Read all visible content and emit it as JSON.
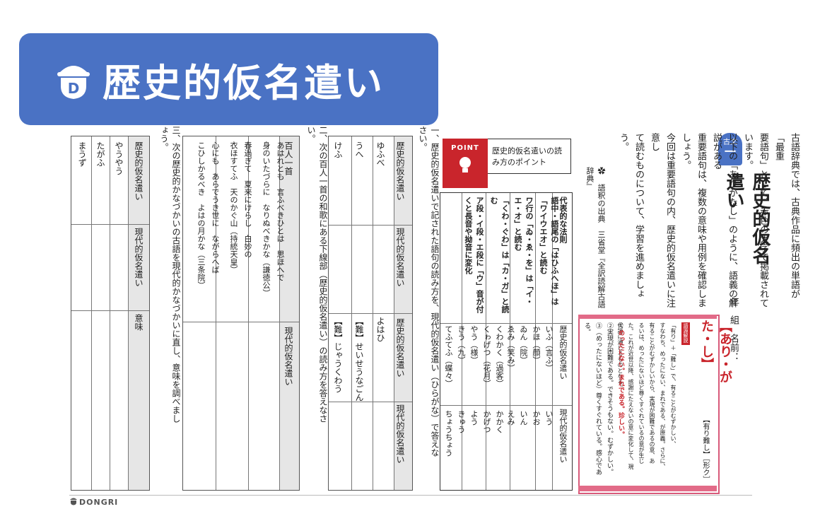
{
  "banner": {
    "title": "歴史的仮名遣い"
  },
  "header": {
    "badge_label": "古文",
    "badge_number": "一",
    "title": "歴史的仮名遣い",
    "meta": "年　組　名前：",
    "paragraphs": [
      "古語辞典では、古典作品に頻出の単語が「最重",
      "要語句」として、赤色の太字で掲載されています。",
      "以下の「ありがたし」のように、語義の解説がある",
      "重要語句は、複数の意味や用例を確認しましょう。",
      "今回は重要語句の内、歴史的仮名遣いに注意し",
      "て読むものについて、学習を進めましょう。"
    ],
    "source_note": "✿ 語釈の出典　三省堂『全訳読解古語辞典』"
  },
  "dictionary": {
    "headword": "【あり・がた・し】",
    "subtitle": "【有り難し】［形ク］",
    "etym_label": "語源解説",
    "body": [
      "「有り」＋「難し」で、有ることがむずかしい、",
      "すなわち、めったにない、まれである、が原義。さらに、",
      "有ることがむずかしいから、実現が困難であるの意、あ",
      "るいは、めったにないほど尊くすぐれているの意が生じ",
      "た。これが近世以降、感謝にたえないの意に変化して、現",
      "代語に通じるものとなる。"
    ],
    "senses": [
      {
        "num": "①",
        "text": "めったにない。まれである。珍しい。"
      },
      {
        "num": "②",
        "text": "実現が困難である。できそうもない。むずかしい。"
      },
      {
        "num": "③",
        "text": "（めったにないほど）尊くすぐれている。感心である。"
      }
    ]
  },
  "point": {
    "badge": "POINT",
    "heading": "歴史的仮名遣いの読み方のポイント",
    "col_headers": [
      "代表的な法則",
      "歴史的仮名遣い",
      "現代的仮名遣い"
    ],
    "rules": [
      {
        "rule": "語中・語尾の「はひふへほ」は「ワイウエオ」と読む",
        "examples": [
          "いふ（言ふ）",
          "かほ（顔）"
        ],
        "answers": [
          "いう",
          "かお"
        ]
      },
      {
        "rule": "ワ行の「ゐ・ゑ・を」は「イ・エ・オ」と読む",
        "examples": [
          "ゐん（院）",
          "ゑみ（笑み）"
        ],
        "answers": [
          "いん",
          "えみ"
        ]
      },
      {
        "rule": "「くわ・ぐわ」は「カ・ガ」と読む",
        "examples": [
          "くわかく（過客）",
          "くゎげつ（花月）"
        ],
        "answers": [
          "かかく",
          "かげつ"
        ]
      },
      {
        "rule": "ア段・イ段・エ段に「ウ」音が付くと長音や拗音に変化",
        "examples": [
          "やう（様）",
          "きう（九）",
          "てふてふ（蝶々）"
        ],
        "answers": [
          "よう",
          "きゅう",
          "ちょうちょう"
        ]
      }
    ]
  },
  "q1": {
    "prompt": "一、歴史的仮名遣いで記された語句の読み方を、現代的仮名遣い（ひらがな）で答えなさい。",
    "col_headers": [
      "歴史的仮名遣い",
      "現代的仮名遣い",
      "歴史的仮名遣い",
      "現代的仮名遣い"
    ],
    "left_items": [
      "ゆふべ",
      "うへ",
      "けふ"
    ],
    "right_items": [
      "よはひ",
      "【難】せいせうなごん",
      "【難】じゃうくわう"
    ]
  },
  "q2": {
    "prompt": "二、次の百人一首の和歌にある下線部（歴史的仮名遣い）の読み方を答えなさい。",
    "col_headers": [
      "百人一首",
      "現代的仮名遣い"
    ],
    "poems": [
      {
        "lines": [
          "あはれとも　言ふべきひとは　思ほへで",
          "身のいたづらに　なりぬべきかな（謙徳公）"
        ]
      },
      {
        "lines": [
          "春過ぎて　夏来にけらし　白妙の",
          "衣ほすてふ　天のかぐ山（持統天皇）"
        ]
      },
      {
        "lines": [
          "心にも　あらでうき世に　ながらへば",
          "こひしかるべき　よはの月かな（三条院）"
        ]
      }
    ]
  },
  "q3": {
    "prompt": "三、次の歴史的かなづかいの古語を現代的かなづかいに直し、意味を調べましょう。",
    "col_headers": [
      "歴史的仮名遣い",
      "現代的仮名遣い",
      "意味"
    ],
    "items": [
      "やうやう",
      "たがふ",
      "まうず"
    ]
  },
  "footer": {
    "brand": "DONGRI"
  }
}
